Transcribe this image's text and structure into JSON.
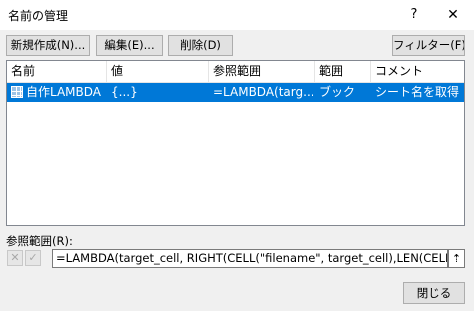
{
  "window": {
    "title": "名前の管理",
    "help": "?",
    "close": "✕"
  },
  "toolbar": {
    "new": "新規作成(N)...",
    "edit": "編集(E)...",
    "delete": "削除(D)",
    "filter": "フィルター(F) ▾"
  },
  "list": {
    "columns": [
      "名前",
      "値",
      "参照範囲",
      "範囲",
      "コメント"
    ],
    "rows": [
      {
        "name": "自作LAMBDA",
        "value": "{...}",
        "refers_to": "=LAMBDA(targ...",
        "scope": "ブック",
        "comment": "シート名を取得"
      }
    ]
  },
  "reference": {
    "label": "参照範囲(R):",
    "cancel_icon": "✕",
    "confirm_icon": "✓",
    "formula": "=LAMBDA(target_cell, RIGHT(CELL(\"filename\", target_cell),LEN(CELL(\"filename\", target_cell))-FIND(\"]\",CELL(\"filename\", target_cell))))",
    "collapse_icon": "⇡"
  },
  "footer": {
    "close": "閉じる"
  },
  "colors": {
    "selection": "#0078d7",
    "dialog_bg": "#f0f0f0"
  }
}
